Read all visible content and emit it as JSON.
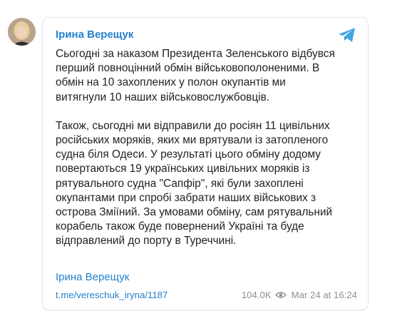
{
  "channel": {
    "name": "Ірина Верещук",
    "accent_color": "#2481cc",
    "icon": "telegram-icon"
  },
  "avatar": {
    "icon": "avatar"
  },
  "message": {
    "lines": [
      "Сьогодні за наказом Президента Зеленського відбувся",
      "перший повноцінний обмін військовополоненими. В",
      "обмін на 10 захоплених у полон окупантів ми",
      "витягнули 10 наших військовослужбовців.",
      "",
      "Також, сьогодні ми відправили до росіян 11 цивільних",
      "російських моряків, яких ми врятували із затопленого",
      "судна біля Одеси. У результаті цього обміну додому",
      "повертаються 19 українських цивільних моряків із",
      "рятувального судна \"Сапфір\", які були захоплені",
      "окупантами при спробі забрати наших військових з",
      "острова Зміїний. За умовами обміну, сам рятувальний",
      "корабель також буде повернений Україні та буде",
      "відправлений до порту в Туреччині."
    ]
  },
  "footer": {
    "author": "Ірина Верещук",
    "link": "t.me/vereschuk_iryna/1187",
    "views": "104.0K",
    "views_icon": "eye-icon",
    "timestamp": "Mar 24 at 16:24"
  }
}
